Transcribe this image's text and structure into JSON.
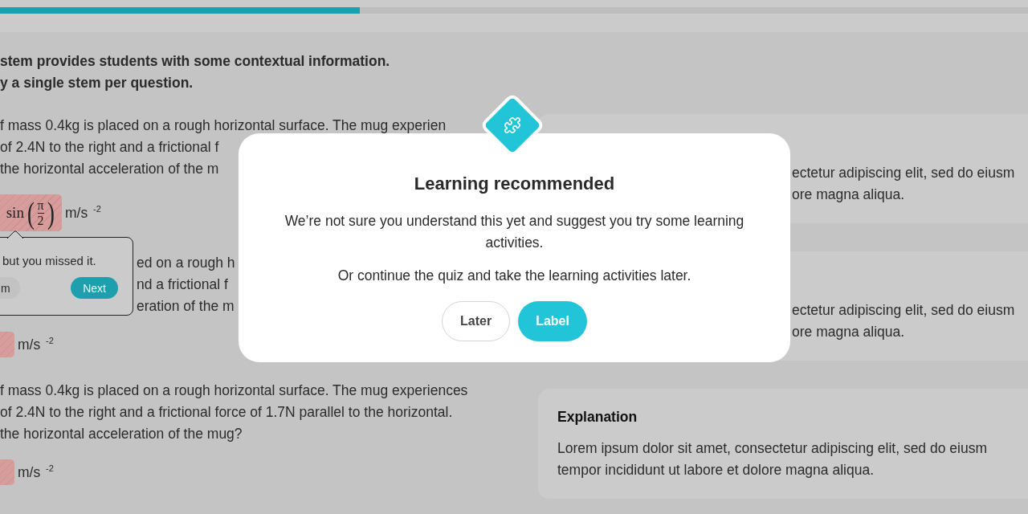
{
  "progress": {
    "level": 0.35
  },
  "intro": [
    "stem provides students with some contextual information.",
    "y a single stem per question."
  ],
  "questions": [
    {
      "lines": [
        "f mass 0.4kg is placed on a rough horizontal surface. The mug experien",
        "of 2.4N to the right and a frictional f",
        "the horizontal acceleration of the m"
      ],
      "answer": {
        "kind": "math",
        "func": "sin",
        "open": "(",
        "numerator": "π",
        "denominator": "2",
        "close": ")",
        "unit": "m/s $^{-2}$",
        "feedback": {
          "text": "but you missed it.",
          "buttons": [
            {
              "label": "m",
              "kind": "secondary"
            },
            {
              "label": "Next",
              "kind": "primary"
            }
          ]
        }
      }
    },
    {
      "lines": [
        "ed on a rough h",
        "nd a frictional f",
        "eration of the m"
      ],
      "answer": {
        "kind": "blank",
        "unit": "m/s $^{-2}$"
      }
    },
    {
      "lines": [
        "f mass 0.4kg is placed on a rough horizontal surface. The mug experiences",
        "of 2.4N to the right and a frictional force of 1.7N parallel to the horizontal.",
        "the horizontal acceleration of the mug?"
      ],
      "answer": {
        "kind": "blank",
        "unit": "m/s $^{-2}$"
      }
    }
  ],
  "cards": [
    {
      "lines": [
        "ectetur adipiscing elit, sed do eiusm",
        "ore magna aliqua."
      ]
    },
    {
      "lines": [
        "ectetur adipiscing elit, sed do eiusm",
        "ore magna aliqua."
      ]
    },
    {
      "title": "Explanation",
      "lines": [
        "Lorem ipsum dolor sit amet, consectetur adipiscing elit, sed do eiusm",
        "tempor incididunt ut labore et dolore magna aliqua."
      ]
    }
  ],
  "modal": {
    "title": "Learning recommended",
    "paragraphs": [
      "We’re not sure you understand this yet and suggest you try some learning activities.",
      "Or continue the quiz and take the learning activities later."
    ],
    "buttons": [
      {
        "label": "Later",
        "kind": "secondary"
      },
      {
        "label": "Label",
        "kind": "primary"
      }
    ]
  }
}
